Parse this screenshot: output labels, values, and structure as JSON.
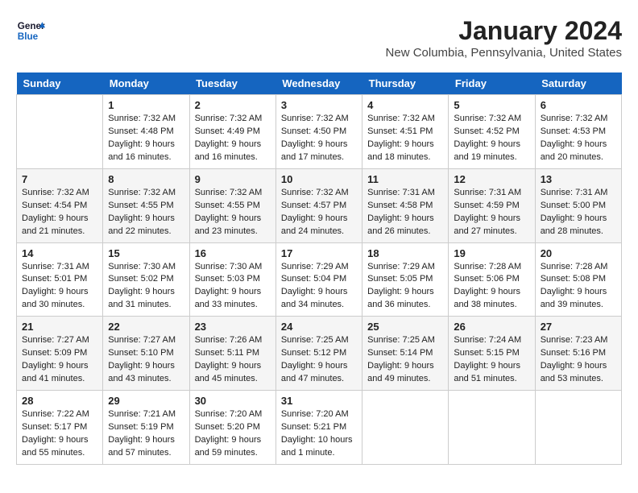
{
  "header": {
    "logo_line1": "General",
    "logo_line2": "Blue",
    "month_title": "January 2024",
    "location": "New Columbia, Pennsylvania, United States"
  },
  "days_of_week": [
    "Sunday",
    "Monday",
    "Tuesday",
    "Wednesday",
    "Thursday",
    "Friday",
    "Saturday"
  ],
  "weeks": [
    [
      {
        "day": "",
        "sunrise": "",
        "sunset": "",
        "daylight": ""
      },
      {
        "day": "1",
        "sunrise": "Sunrise: 7:32 AM",
        "sunset": "Sunset: 4:48 PM",
        "daylight": "Daylight: 9 hours and 16 minutes."
      },
      {
        "day": "2",
        "sunrise": "Sunrise: 7:32 AM",
        "sunset": "Sunset: 4:49 PM",
        "daylight": "Daylight: 9 hours and 16 minutes."
      },
      {
        "day": "3",
        "sunrise": "Sunrise: 7:32 AM",
        "sunset": "Sunset: 4:50 PM",
        "daylight": "Daylight: 9 hours and 17 minutes."
      },
      {
        "day": "4",
        "sunrise": "Sunrise: 7:32 AM",
        "sunset": "Sunset: 4:51 PM",
        "daylight": "Daylight: 9 hours and 18 minutes."
      },
      {
        "day": "5",
        "sunrise": "Sunrise: 7:32 AM",
        "sunset": "Sunset: 4:52 PM",
        "daylight": "Daylight: 9 hours and 19 minutes."
      },
      {
        "day": "6",
        "sunrise": "Sunrise: 7:32 AM",
        "sunset": "Sunset: 4:53 PM",
        "daylight": "Daylight: 9 hours and 20 minutes."
      }
    ],
    [
      {
        "day": "7",
        "sunrise": "Sunrise: 7:32 AM",
        "sunset": "Sunset: 4:54 PM",
        "daylight": "Daylight: 9 hours and 21 minutes."
      },
      {
        "day": "8",
        "sunrise": "Sunrise: 7:32 AM",
        "sunset": "Sunset: 4:55 PM",
        "daylight": "Daylight: 9 hours and 22 minutes."
      },
      {
        "day": "9",
        "sunrise": "Sunrise: 7:32 AM",
        "sunset": "Sunset: 4:55 PM",
        "daylight": "Daylight: 9 hours and 23 minutes."
      },
      {
        "day": "10",
        "sunrise": "Sunrise: 7:32 AM",
        "sunset": "Sunset: 4:57 PM",
        "daylight": "Daylight: 9 hours and 24 minutes."
      },
      {
        "day": "11",
        "sunrise": "Sunrise: 7:31 AM",
        "sunset": "Sunset: 4:58 PM",
        "daylight": "Daylight: 9 hours and 26 minutes."
      },
      {
        "day": "12",
        "sunrise": "Sunrise: 7:31 AM",
        "sunset": "Sunset: 4:59 PM",
        "daylight": "Daylight: 9 hours and 27 minutes."
      },
      {
        "day": "13",
        "sunrise": "Sunrise: 7:31 AM",
        "sunset": "Sunset: 5:00 PM",
        "daylight": "Daylight: 9 hours and 28 minutes."
      }
    ],
    [
      {
        "day": "14",
        "sunrise": "Sunrise: 7:31 AM",
        "sunset": "Sunset: 5:01 PM",
        "daylight": "Daylight: 9 hours and 30 minutes."
      },
      {
        "day": "15",
        "sunrise": "Sunrise: 7:30 AM",
        "sunset": "Sunset: 5:02 PM",
        "daylight": "Daylight: 9 hours and 31 minutes."
      },
      {
        "day": "16",
        "sunrise": "Sunrise: 7:30 AM",
        "sunset": "Sunset: 5:03 PM",
        "daylight": "Daylight: 9 hours and 33 minutes."
      },
      {
        "day": "17",
        "sunrise": "Sunrise: 7:29 AM",
        "sunset": "Sunset: 5:04 PM",
        "daylight": "Daylight: 9 hours and 34 minutes."
      },
      {
        "day": "18",
        "sunrise": "Sunrise: 7:29 AM",
        "sunset": "Sunset: 5:05 PM",
        "daylight": "Daylight: 9 hours and 36 minutes."
      },
      {
        "day": "19",
        "sunrise": "Sunrise: 7:28 AM",
        "sunset": "Sunset: 5:06 PM",
        "daylight": "Daylight: 9 hours and 38 minutes."
      },
      {
        "day": "20",
        "sunrise": "Sunrise: 7:28 AM",
        "sunset": "Sunset: 5:08 PM",
        "daylight": "Daylight: 9 hours and 39 minutes."
      }
    ],
    [
      {
        "day": "21",
        "sunrise": "Sunrise: 7:27 AM",
        "sunset": "Sunset: 5:09 PM",
        "daylight": "Daylight: 9 hours and 41 minutes."
      },
      {
        "day": "22",
        "sunrise": "Sunrise: 7:27 AM",
        "sunset": "Sunset: 5:10 PM",
        "daylight": "Daylight: 9 hours and 43 minutes."
      },
      {
        "day": "23",
        "sunrise": "Sunrise: 7:26 AM",
        "sunset": "Sunset: 5:11 PM",
        "daylight": "Daylight: 9 hours and 45 minutes."
      },
      {
        "day": "24",
        "sunrise": "Sunrise: 7:25 AM",
        "sunset": "Sunset: 5:12 PM",
        "daylight": "Daylight: 9 hours and 47 minutes."
      },
      {
        "day": "25",
        "sunrise": "Sunrise: 7:25 AM",
        "sunset": "Sunset: 5:14 PM",
        "daylight": "Daylight: 9 hours and 49 minutes."
      },
      {
        "day": "26",
        "sunrise": "Sunrise: 7:24 AM",
        "sunset": "Sunset: 5:15 PM",
        "daylight": "Daylight: 9 hours and 51 minutes."
      },
      {
        "day": "27",
        "sunrise": "Sunrise: 7:23 AM",
        "sunset": "Sunset: 5:16 PM",
        "daylight": "Daylight: 9 hours and 53 minutes."
      }
    ],
    [
      {
        "day": "28",
        "sunrise": "Sunrise: 7:22 AM",
        "sunset": "Sunset: 5:17 PM",
        "daylight": "Daylight: 9 hours and 55 minutes."
      },
      {
        "day": "29",
        "sunrise": "Sunrise: 7:21 AM",
        "sunset": "Sunset: 5:19 PM",
        "daylight": "Daylight: 9 hours and 57 minutes."
      },
      {
        "day": "30",
        "sunrise": "Sunrise: 7:20 AM",
        "sunset": "Sunset: 5:20 PM",
        "daylight": "Daylight: 9 hours and 59 minutes."
      },
      {
        "day": "31",
        "sunrise": "Sunrise: 7:20 AM",
        "sunset": "Sunset: 5:21 PM",
        "daylight": "Daylight: 10 hours and 1 minute."
      },
      {
        "day": "",
        "sunrise": "",
        "sunset": "",
        "daylight": ""
      },
      {
        "day": "",
        "sunrise": "",
        "sunset": "",
        "daylight": ""
      },
      {
        "day": "",
        "sunrise": "",
        "sunset": "",
        "daylight": ""
      }
    ]
  ]
}
